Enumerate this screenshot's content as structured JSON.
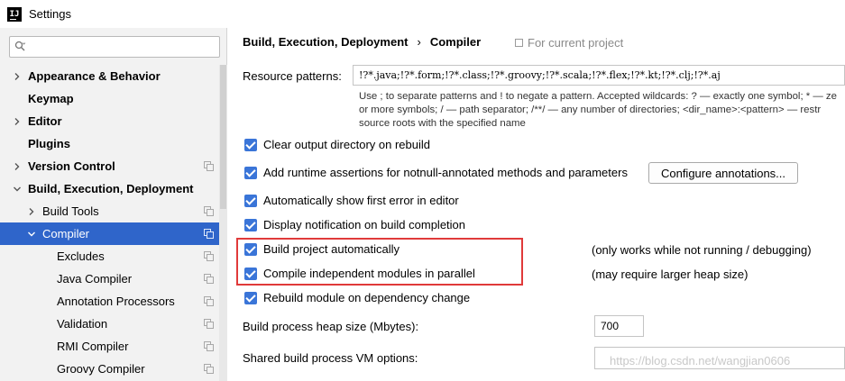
{
  "window": {
    "title": "Settings",
    "icon_text": "IJ"
  },
  "search": {
    "placeholder": "",
    "value": ""
  },
  "sidebar": {
    "items": [
      {
        "label": "Appearance & Behavior",
        "level": 0,
        "bold": true,
        "expandable": true,
        "expanded": false,
        "project_icon": false,
        "selected": false
      },
      {
        "label": "Keymap",
        "level": 0,
        "bold": true,
        "expandable": false,
        "expanded": false,
        "project_icon": false,
        "selected": false
      },
      {
        "label": "Editor",
        "level": 0,
        "bold": true,
        "expandable": true,
        "expanded": false,
        "project_icon": false,
        "selected": false
      },
      {
        "label": "Plugins",
        "level": 0,
        "bold": true,
        "expandable": false,
        "expanded": false,
        "project_icon": false,
        "selected": false
      },
      {
        "label": "Version Control",
        "level": 0,
        "bold": true,
        "expandable": true,
        "expanded": false,
        "project_icon": true,
        "selected": false
      },
      {
        "label": "Build, Execution, Deployment",
        "level": 0,
        "bold": true,
        "expandable": true,
        "expanded": true,
        "project_icon": false,
        "selected": false
      },
      {
        "label": "Build Tools",
        "level": 1,
        "bold": false,
        "expandable": true,
        "expanded": false,
        "project_icon": true,
        "selected": false
      },
      {
        "label": "Compiler",
        "level": 1,
        "bold": false,
        "expandable": true,
        "expanded": true,
        "project_icon": true,
        "selected": true
      },
      {
        "label": "Excludes",
        "level": 2,
        "bold": false,
        "expandable": false,
        "expanded": false,
        "project_icon": true,
        "selected": false
      },
      {
        "label": "Java Compiler",
        "level": 2,
        "bold": false,
        "expandable": false,
        "expanded": false,
        "project_icon": true,
        "selected": false
      },
      {
        "label": "Annotation Processors",
        "level": 2,
        "bold": false,
        "expandable": false,
        "expanded": false,
        "project_icon": true,
        "selected": false
      },
      {
        "label": "Validation",
        "level": 2,
        "bold": false,
        "expandable": false,
        "expanded": false,
        "project_icon": true,
        "selected": false
      },
      {
        "label": "RMI Compiler",
        "level": 2,
        "bold": false,
        "expandable": false,
        "expanded": false,
        "project_icon": true,
        "selected": false
      },
      {
        "label": "Groovy Compiler",
        "level": 2,
        "bold": false,
        "expandable": false,
        "expanded": false,
        "project_icon": true,
        "selected": false
      }
    ]
  },
  "main": {
    "breadcrumb": {
      "parent": "Build, Execution, Deployment",
      "separator": "›",
      "current": "Compiler"
    },
    "scope_note": "For current project",
    "resource_patterns": {
      "label": "Resource patterns:",
      "value": "!?*.java;!?*.form;!?*.class;!?*.groovy;!?*.scala;!?*.flex;!?*.kt;!?*.clj;!?*.aj",
      "hint_line1": "Use ; to separate patterns and ! to negate a pattern. Accepted wildcards: ? — exactly one symbol; * — ze",
      "hint_line2": "or more symbols; / — path separator; /**/ — any number of directories; <dir_name>:<pattern> — restr",
      "hint_line3": "source roots with the specified name"
    },
    "options": {
      "clear_output": {
        "label": "Clear output directory on rebuild",
        "checked": true
      },
      "runtime_assertions": {
        "label": "Add runtime assertions for notnull-annotated methods and parameters",
        "checked": true
      },
      "show_first_error": {
        "label": "Automatically show first error in editor",
        "checked": true
      },
      "display_notification": {
        "label": "Display notification on build completion",
        "checked": true
      },
      "build_automatically": {
        "label": "Build project automatically",
        "checked": true,
        "note": "(only works while not running / debugging)"
      },
      "compile_parallel": {
        "label": "Compile independent modules in parallel",
        "checked": true,
        "note": "(may require larger heap size)"
      },
      "rebuild_on_change": {
        "label": "Rebuild module on dependency change",
        "checked": true
      }
    },
    "configure_button": "Configure annotations...",
    "heap_size": {
      "label": "Build process heap size (Mbytes):",
      "value": "700"
    },
    "vm_options": {
      "label": "Shared build process VM options:",
      "value": ""
    }
  },
  "watermark": "https://blog.csdn.net/wangjian0606",
  "colors": {
    "selection": "#2f65ca",
    "checkbox": "#3a75d8",
    "highlight_border": "#e03a3a",
    "sidebar_bg": "#f2f2f2"
  }
}
